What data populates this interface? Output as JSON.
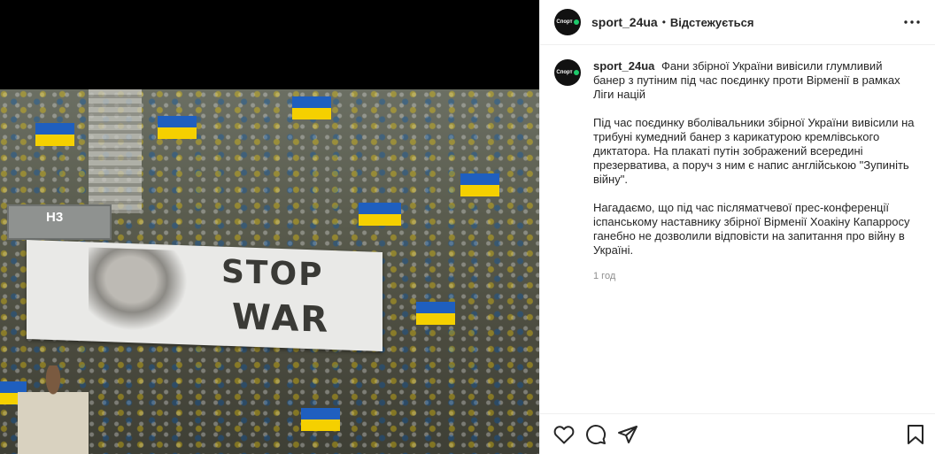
{
  "photo": {
    "tunnel_label": "H3",
    "banner_line1": "STOP",
    "banner_line2": "WAR"
  },
  "header": {
    "avatar_text": "Спорт",
    "username": "sport_24ua",
    "separator": "•",
    "follow_status": "Відстежується",
    "more_icon": "more-horizontal-icon"
  },
  "caption": {
    "username": "sport_24ua",
    "headline": "Фани збірної України вивісили глумливий банер з путіним під час поєдинку проти Вірменії в рамках Ліги націй",
    "paragraph1": "Під час поєдинку вболівальники збірної України вивісили на трибуні кумедний банер з карикатурою кремлівського диктатора. На плакаті путін зображений всередині презерватива, а поруч з ним є напис англійською \"Зупиніть війну\".",
    "paragraph2": "Нагадаємо, що під час післяматчевої прес-конференції іспанському наставнику збірної Вірменії Хоакіну Капарросу ганебно не дозволили відповісти на запитання про війну в Україні.",
    "timestamp": "1 год"
  },
  "actions": {
    "icons": [
      "heart-icon",
      "comment-icon",
      "share-icon",
      "bookmark-icon"
    ]
  },
  "colors": {
    "flag_blue": "#1f5fbf",
    "flag_yellow": "#f5d000",
    "brand_green": "#1ec96b",
    "muted_text": "#8e8e8e"
  }
}
